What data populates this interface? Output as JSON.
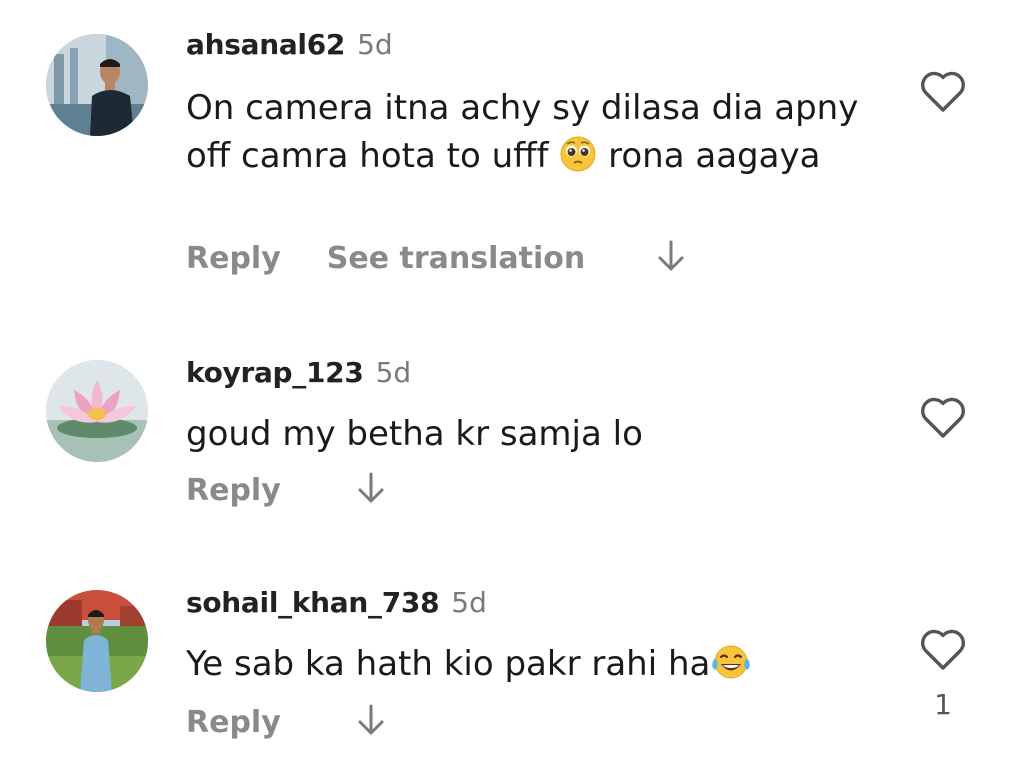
{
  "comments": [
    {
      "username": "ahsanal62",
      "time": "5d",
      "text_part1": "On camera itna achy sy dilasa dia apny off camra hota to ufff",
      "emoji": "pleading-face",
      "text_part2": "rona aagaya",
      "reply_label": "Reply",
      "translate_label": "See translation",
      "like_count": ""
    },
    {
      "username": "koyrap_123",
      "time": "5d",
      "text_part1": "goud my betha kr samja lo",
      "reply_label": "Reply",
      "like_count": ""
    },
    {
      "username": "sohail_khan_738",
      "time": "5d",
      "text_part1": "Ye sab ka hath kio pakr rahi ha",
      "emoji": "tears-of-joy",
      "reply_label": "Reply",
      "like_count": "1"
    }
  ],
  "colors": {
    "username": "#222222",
    "meta_gray": "#7a7a7a",
    "action_gray": "#8a8a8a",
    "emoji_yellow": "#f7c43a"
  },
  "icons": {
    "like": "heart-outline-icon",
    "expand": "arrow-down-icon"
  }
}
